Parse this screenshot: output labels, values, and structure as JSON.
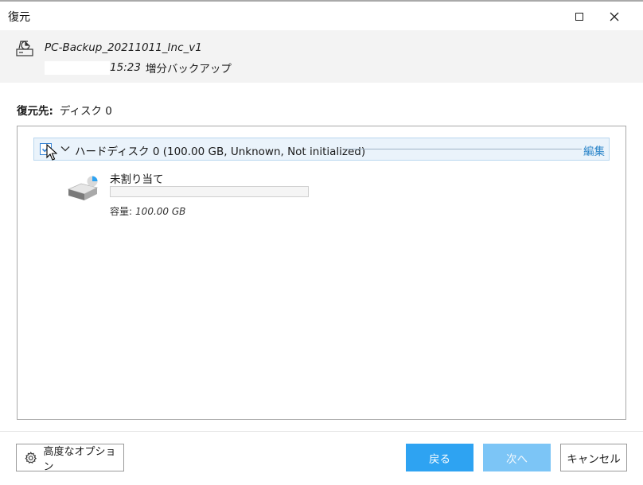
{
  "window": {
    "title": "復元"
  },
  "backup": {
    "icon": "backup-drive-icon",
    "name": "PC-Backup_20211011_Inc_v1",
    "time": "15:23",
    "type": "増分バックアップ"
  },
  "destination": {
    "label": "復元先:",
    "value": "ディスク 0"
  },
  "disk": {
    "checked": true,
    "label": "ハードディスク 0 (100.00 GB, Unknown, Not initialized)",
    "edit_label": "編集",
    "partition": {
      "name": "未割り当て",
      "capacity_label": "容量:",
      "capacity_value": "100.00 GB",
      "used_fraction": 0
    }
  },
  "footer": {
    "advanced_label": "高度なオプション",
    "back_label": "戻る",
    "next_label": "次へ",
    "cancel_label": "キャンセル"
  },
  "colors": {
    "accent": "#2ea3f2",
    "accent_disabled": "#7cc5f6",
    "link": "#2a84c9",
    "row_highlight": "#eaf3fb"
  }
}
